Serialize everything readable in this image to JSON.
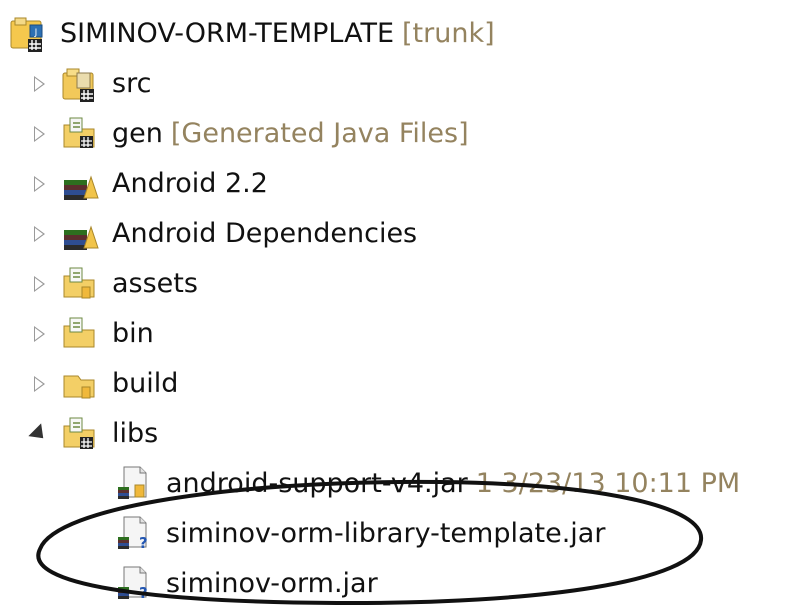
{
  "project": {
    "label": "SIMINOV-ORM-TEMPLATE",
    "decoration": "[trunk]"
  },
  "tree": [
    {
      "label": "src",
      "decoration": "",
      "icon": "source-package-icon",
      "state": "collapsed"
    },
    {
      "label": "gen",
      "decoration": "[Generated Java Files]",
      "icon": "generated-folder-icon",
      "state": "collapsed"
    },
    {
      "label": "Android 2.2",
      "decoration": "",
      "icon": "library-container-icon",
      "state": "collapsed"
    },
    {
      "label": "Android Dependencies",
      "decoration": "",
      "icon": "library-container-icon",
      "state": "collapsed"
    },
    {
      "label": "assets",
      "decoration": "",
      "icon": "folder-versioned-icon",
      "state": "collapsed"
    },
    {
      "label": "bin",
      "decoration": "",
      "icon": "folder-versioned-icon",
      "state": "collapsed"
    },
    {
      "label": "build",
      "decoration": "",
      "icon": "folder-icon",
      "state": "collapsed"
    },
    {
      "label": "libs",
      "decoration": "",
      "icon": "folder-versioned-icon",
      "state": "expanded"
    }
  ],
  "libs_children": [
    {
      "label": "android-support-v4.jar",
      "decoration": "1  3/23/13 10:11 PM",
      "icon": "jar-versioned-icon"
    },
    {
      "label": "siminov-orm-library-template.jar",
      "decoration": "",
      "icon": "jar-unversioned-icon"
    },
    {
      "label": "siminov-orm.jar",
      "decoration": "",
      "icon": "jar-unversioned-icon"
    }
  ],
  "colors": {
    "background": "#ffffff",
    "text": "#111111",
    "decoration": "#94835f",
    "folder": "#f3cf66",
    "ellipse": "#111111"
  }
}
